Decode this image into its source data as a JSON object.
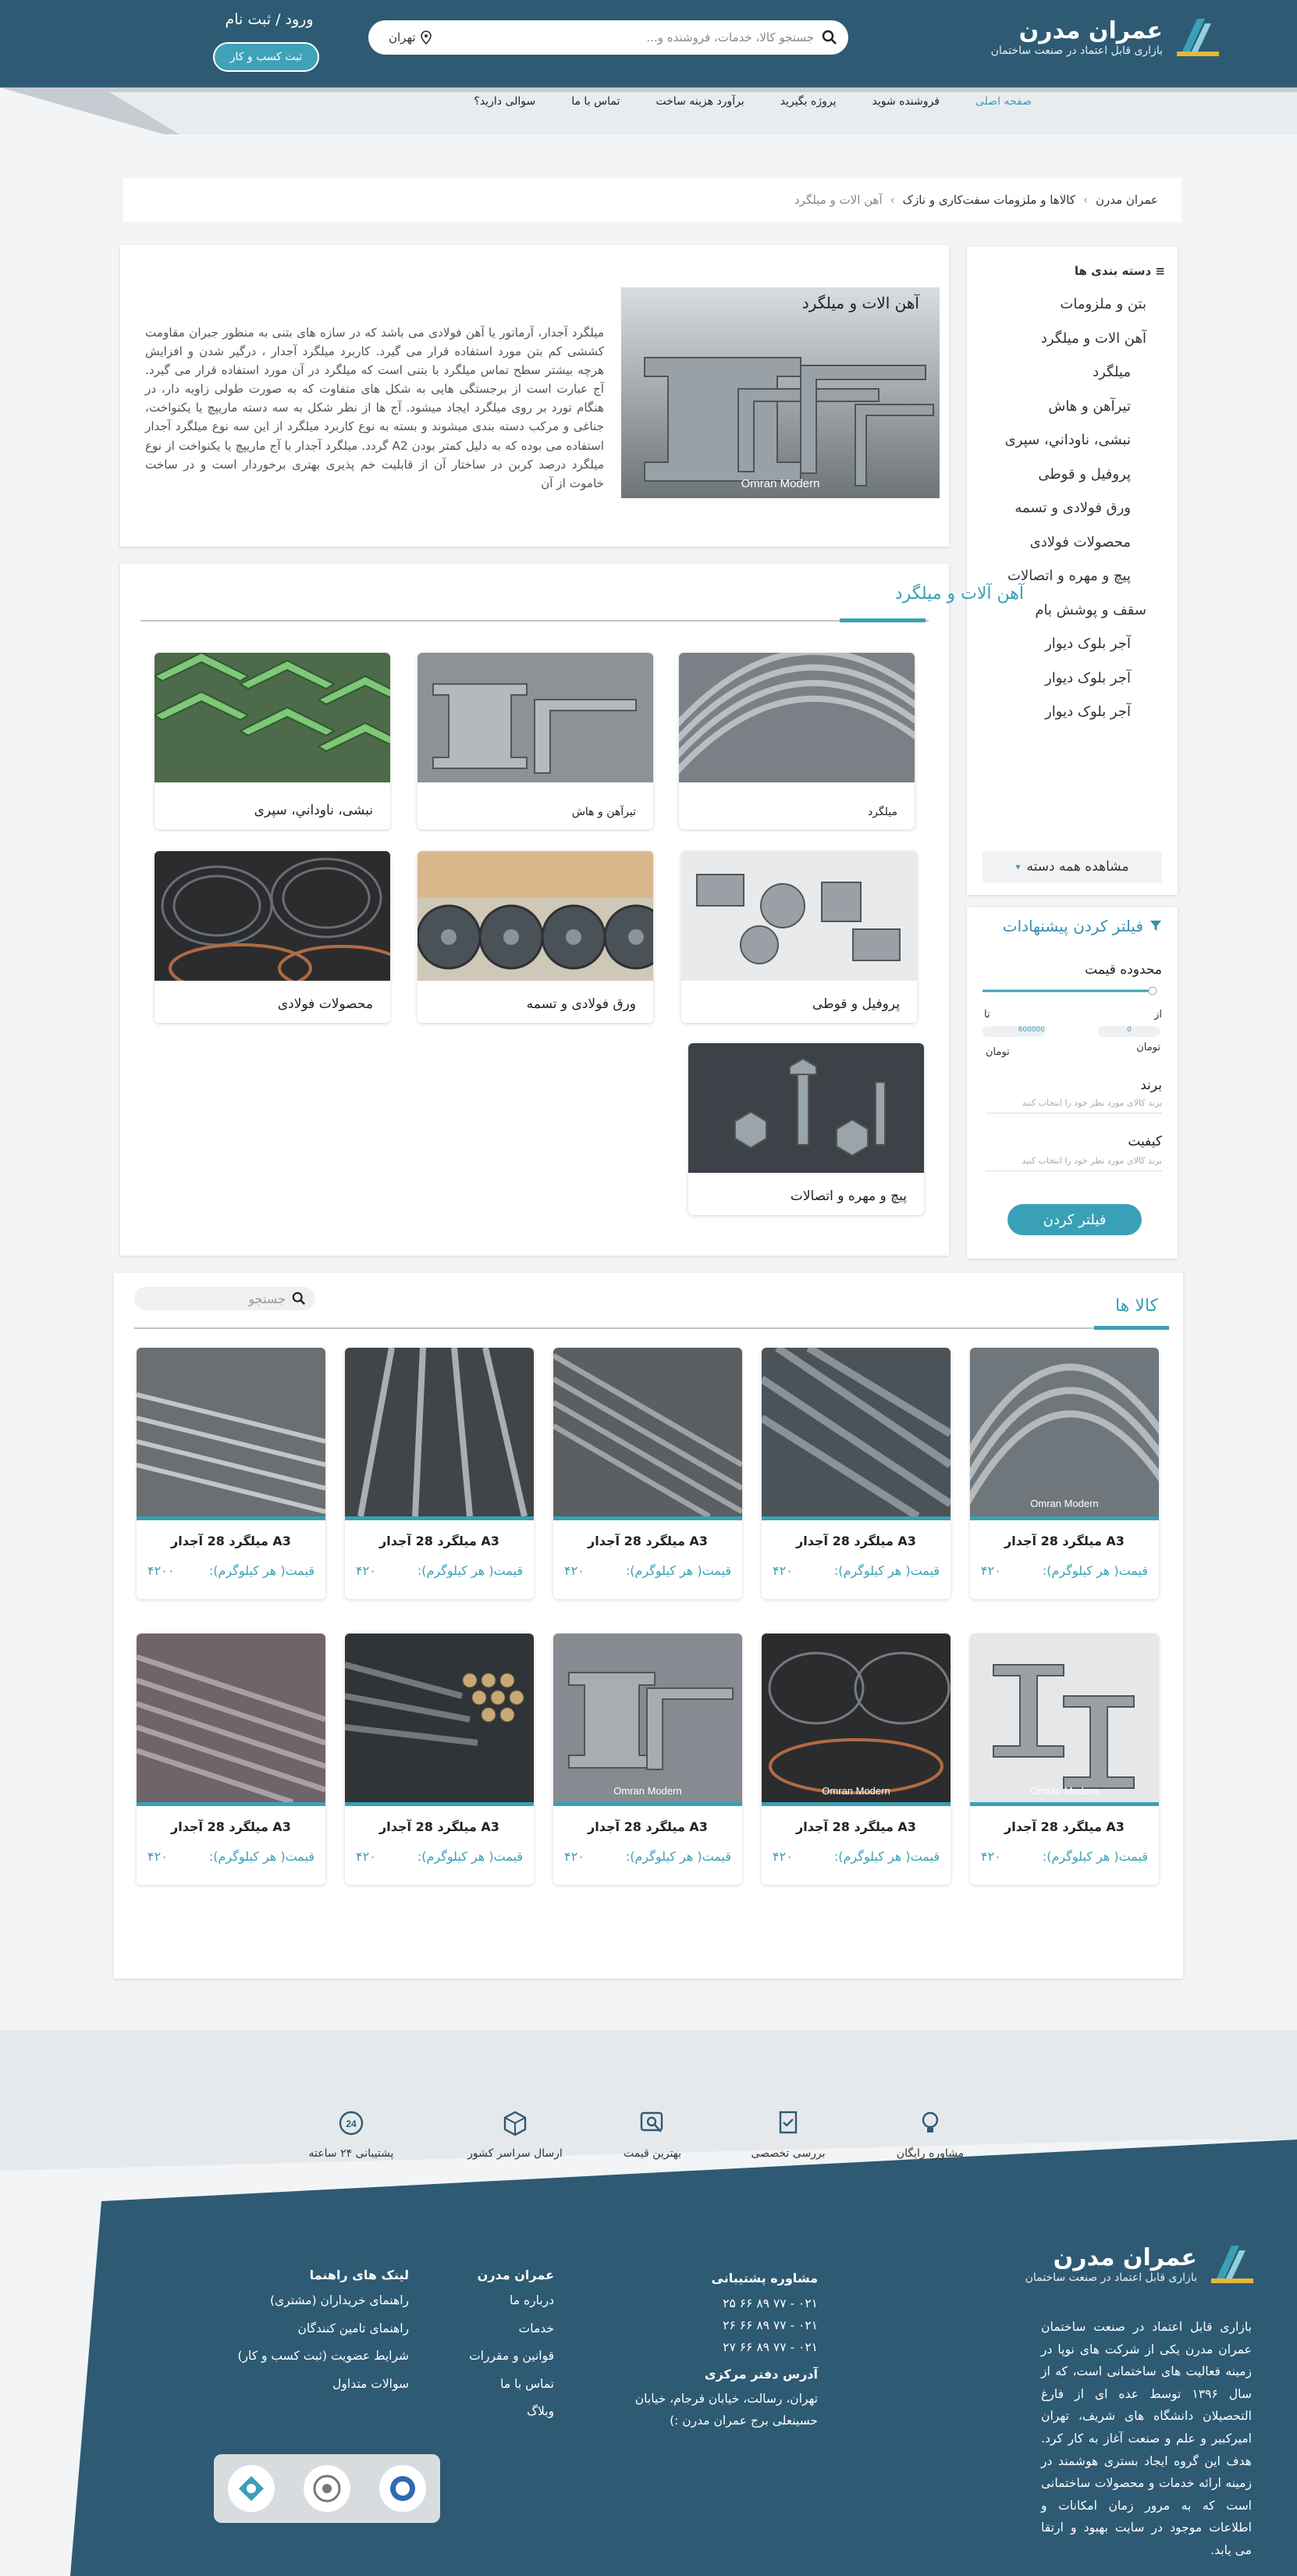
{
  "header": {
    "logo_name": "عمران مدرن",
    "logo_sub": "بازاری قابل اعتماد در صنعت ساختمان",
    "search_placeholder": "جستجو کالا، خدمات، فروشنده و...",
    "city": "تهران",
    "login": "ورود / ثبت نام",
    "register": "ثبت کسب و کار"
  },
  "nav": [
    "صفحه اصلی",
    "فروشنده شوید",
    "پروژه بگیرید",
    "برآورد هزینه ساخت",
    "تماس با ما",
    "سوالی دارید؟"
  ],
  "breadcrumb": [
    "عمران مدرن",
    "کالاها و ملزومات سفت‌کاری و نازک",
    "آهن الات و میلگرد"
  ],
  "sidebar": {
    "title": "دسته بندی ها",
    "items": [
      "بتن و ملزومات",
      "آهن الات و میلگرد",
      "میلگرد",
      "تیرآهن و هاش",
      "نبشی، ناوداني، سپری",
      "پروفیل و قوطی",
      "ورق فولادی و تسمه",
      "محصولات فولادی",
      "پیچ و مهره و اتصالات",
      "سقف و پوشش بام",
      "آجر بلوک دیوار",
      "آجر بلوک دیوار",
      "آجر بلوک دیوار"
    ],
    "more": "مشاهده همه دسته"
  },
  "filter": {
    "title": "فیلتر کردن پیشنهادات",
    "price_label": "محدوده قیمت",
    "from": "از",
    "to": "تا",
    "from_val": "0",
    "to_val": "600000",
    "unit": "تومان",
    "brand_label": "برند",
    "brand_hint": "برند کالای مورد نظر خود را انتخاب کنید",
    "quality_label": "کیفیت",
    "quality_hint": "برند کالای مورد نظر خود را انتخاب کنید",
    "button": "فیلتر کردن"
  },
  "intro": {
    "title": "آهن الات و میلگرد",
    "text": "میلگرد آجدار، آرماتور یا آهن فولادی می باشد که در سازه های بتنی به منظور جبران مقاومت کششی کم بتن مورد استفاده قرار می گیرد. کاربرد میلگرد آجدار ، درگیر شدن و افزایش هرچه بیشتر سطح تماس میلگرد با بتنی است که میلگرد در آن مورد استفاده قرار می گیرد. آج عبارت است از برجستگی هایی به شکل های متفاوت که به صورت طولی زاویه دار، در هنگام تورد بر روی میلگرد ایجاد میشود. آج ها از نظر شکل به سه دسته ماریپچ یا یکنواخت، جناغی و مرکب دسته بندی میشوند و بسته به نوع کاربرد میلگرد از این سه نوع میلگرد آجدار استفاده می بوده که به دلیل کمتر بودن A2 گردد. میلگرد آجدار با آج ماریپچ یا یکنواخت از نوع میلگرد درصد کربن در ساختار آن از قابلیت خم پذیری بهتری برخوردار است و در ساخت خاموت از آن",
    "watermark": "Omran Modern"
  },
  "categories": {
    "title": "آهن آلات و میلگرد",
    "tiles": [
      "میلگرد",
      "تیرآهن و هاش",
      "نبشی، ناوداني، سپری",
      "پروفیل و قوطی",
      "ورق فولادی و تسمه",
      "محصولات فولادی",
      "پیچ و مهره و اتصالات"
    ]
  },
  "products": {
    "title": "کالا ها",
    "search_placeholder": "جستجو",
    "items": [
      {
        "name": "A3 میلگرد 28 آجدار",
        "price_label": "قیمت( هر کیلوگرم):",
        "price": "۴۲۰"
      },
      {
        "name": "A3 میلگرد 28 آجدار",
        "price_label": "قیمت( هر کیلوگرم):",
        "price": "۴۲۰"
      },
      {
        "name": "A3 میلگرد 28 آجدار",
        "price_label": "قیمت( هر کیلوگرم):",
        "price": "۴۲۰"
      },
      {
        "name": "A3 میلگرد 28 آجدار",
        "price_label": "قیمت( هر کیلوگرم):",
        "price": "۴۲۰"
      },
      {
        "name": "A3 میلگرد 28 آجدار",
        "price_label": "قیمت( هر کیلوگرم):",
        "price": "۴۲۰۰"
      },
      {
        "name": "A3 میلگرد 28 آجدار",
        "price_label": "قیمت( هر کیلوگرم):",
        "price": "۴۲۰"
      },
      {
        "name": "A3 میلگرد 28 آجدار",
        "price_label": "قیمت( هر کیلوگرم):",
        "price": "۴۲۰"
      },
      {
        "name": "A3 میلگرد 28 آجدار",
        "price_label": "قیمت( هر کیلوگرم):",
        "price": "۴۲۰"
      },
      {
        "name": "A3 میلگرد 28 آجدار",
        "price_label": "قیمت( هر کیلوگرم):",
        "price": "۴۲۰"
      },
      {
        "name": "A3 میلگرد 28 آجدار",
        "price_label": "قیمت( هر کیلوگرم):",
        "price": "۴۲۰"
      }
    ]
  },
  "features": [
    "مشاوره رایگان",
    "بررسی تخصصی",
    "بهترین قیمت",
    "ارسال سراسر کشور",
    "پشتیبانی ۲۴ ساعته"
  ],
  "footer": {
    "about": "بازاری قابل اعتماد در صنعت ساختمان عمران مدرن یکی از شرکت های نوپا در زمینه فعالیت های ساختمانی است، که از سال ۱۳۹۶ توسط عده ای از فارغ التحصیلان دانشگاه های شریف، تهران امیرکبیر و علم و صنعت آغاز به کار کرد. هدف این گروه ایجاد بستری هوشمند در زمینه ارائه خدمات و محصولات ساختمانی است که به مرور زمان امکانات و اطلاعات موجود در سایت بهبود و ارتقا می یابد.",
    "support_title": "مشاوره پشتیبانی",
    "phones": [
      "۰۲۱ - ۷۷ ۸۹ ۶۶ ۲۵",
      "۰۲۱ - ۷۷ ۸۹ ۶۶ ۲۶",
      "۰۲۱ - ۷۷ ۸۹ ۶۶ ۲۷"
    ],
    "address_title": "آدرس دفتر مرکزی",
    "address": "تهران، رسالت، خیابان فرجام، خیابان حسینعلی برج عمران مدرن :)",
    "col1_title": "عمران مدرن",
    "col1": [
      "درباره ما",
      "خدمات",
      "قوانین و مقررات",
      "تماس با ما",
      "وبلاگ"
    ],
    "col2_title": "لینک های راهنما",
    "col2": [
      "راهنمای خریداران (مشتری)",
      "راهنمای تامین کنندگان",
      "شرایط عضویت (ثبت کسب و کار)",
      "سوالات متداول"
    ]
  },
  "colors": {
    "primary": "#2e5a74",
    "accent": "#3aa0b7"
  }
}
